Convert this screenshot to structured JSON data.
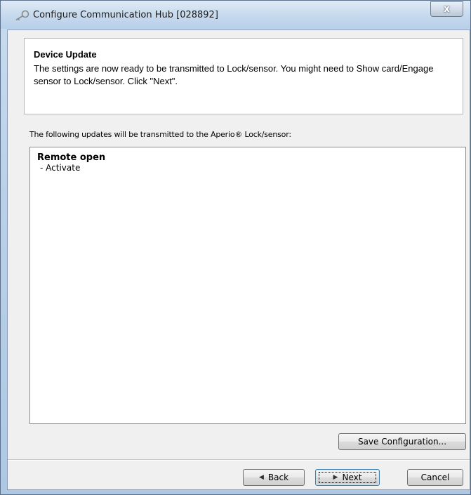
{
  "window": {
    "title": "Configure Communication Hub [028892]",
    "close_label": "x"
  },
  "header": {
    "title": "Device Update",
    "description": "The settings are now ready to be transmitted to Lock/sensor. You might need to Show card/Engage sensor to Lock/sensor. Click \"Next\"."
  },
  "updates": {
    "label": "The following updates will be transmitted to the Aperio® Lock/sensor:",
    "items": [
      {
        "title": "Remote open",
        "detail": "- Activate"
      }
    ]
  },
  "buttons": {
    "save": "Save Configuration...",
    "back": "Back",
    "next": "Next",
    "cancel": "Cancel"
  },
  "icons": {
    "title": "key-icon",
    "back": "triangle-left-icon",
    "next": "triangle-right-icon"
  }
}
